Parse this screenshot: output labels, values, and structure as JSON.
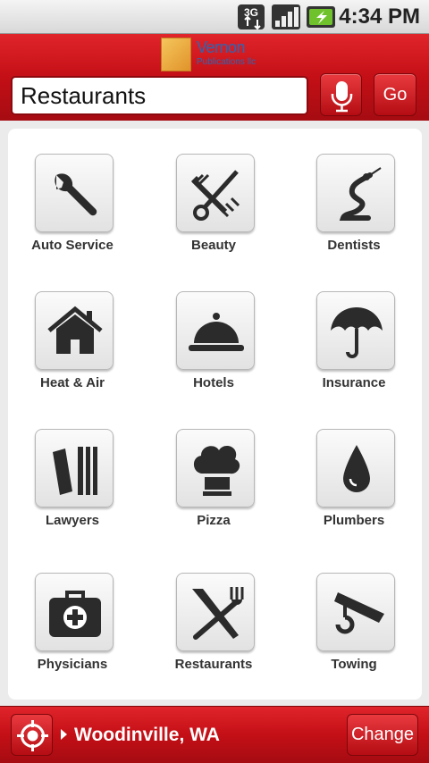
{
  "status_bar": {
    "network": "3G",
    "time": "4:34 PM",
    "icons": [
      "3g-data-icon",
      "signal-icon",
      "battery-charging-icon"
    ]
  },
  "header": {
    "logo": {
      "name": "Vernon",
      "subtitle": "Publications llc"
    },
    "search": {
      "value": "Restaurants"
    },
    "go_label": "Go",
    "mic_icon": "microphone-icon"
  },
  "categories": [
    {
      "label": "Auto Service",
      "icon": "wrench-icon"
    },
    {
      "label": "Beauty",
      "icon": "comb-scissors-icon"
    },
    {
      "label": "Dentists",
      "icon": "dental-tool-icon"
    },
    {
      "label": "Heat & Air",
      "icon": "house-icon"
    },
    {
      "label": "Hotels",
      "icon": "cloche-icon"
    },
    {
      "label": "Insurance",
      "icon": "umbrella-icon"
    },
    {
      "label": "Lawyers",
      "icon": "books-icon"
    },
    {
      "label": "Pizza",
      "icon": "chef-hat-icon"
    },
    {
      "label": "Plumbers",
      "icon": "water-drop-icon"
    },
    {
      "label": "Physicians",
      "icon": "medical-kit-icon"
    },
    {
      "label": "Restaurants",
      "icon": "knife-fork-icon"
    },
    {
      "label": "Towing",
      "icon": "tow-hook-icon"
    }
  ],
  "footer": {
    "location": "Woodinville, WA",
    "change_label": "Change",
    "locate_icon": "crosshair-icon"
  },
  "colors": {
    "brand_red": "#c40f16",
    "icon_dark": "#2b2b2b"
  }
}
